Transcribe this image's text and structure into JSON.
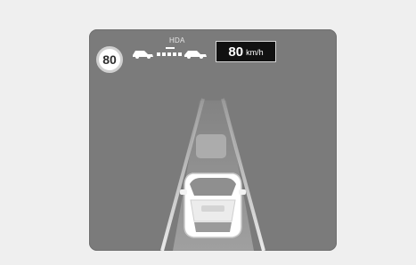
{
  "speed_limit": {
    "value": "80"
  },
  "hda": {
    "label": "HDA"
  },
  "set_speed": {
    "value": "80",
    "unit": "km/h"
  },
  "icons": {
    "lead_vehicle": "car-icon",
    "distance": "distance-bars-icon",
    "own_vehicle": "car-icon"
  },
  "colors": {
    "screen_background": "#7b7b7b",
    "sign_background": "#ffffff",
    "set_speed_background": "#111111",
    "text": "#ffffff"
  }
}
